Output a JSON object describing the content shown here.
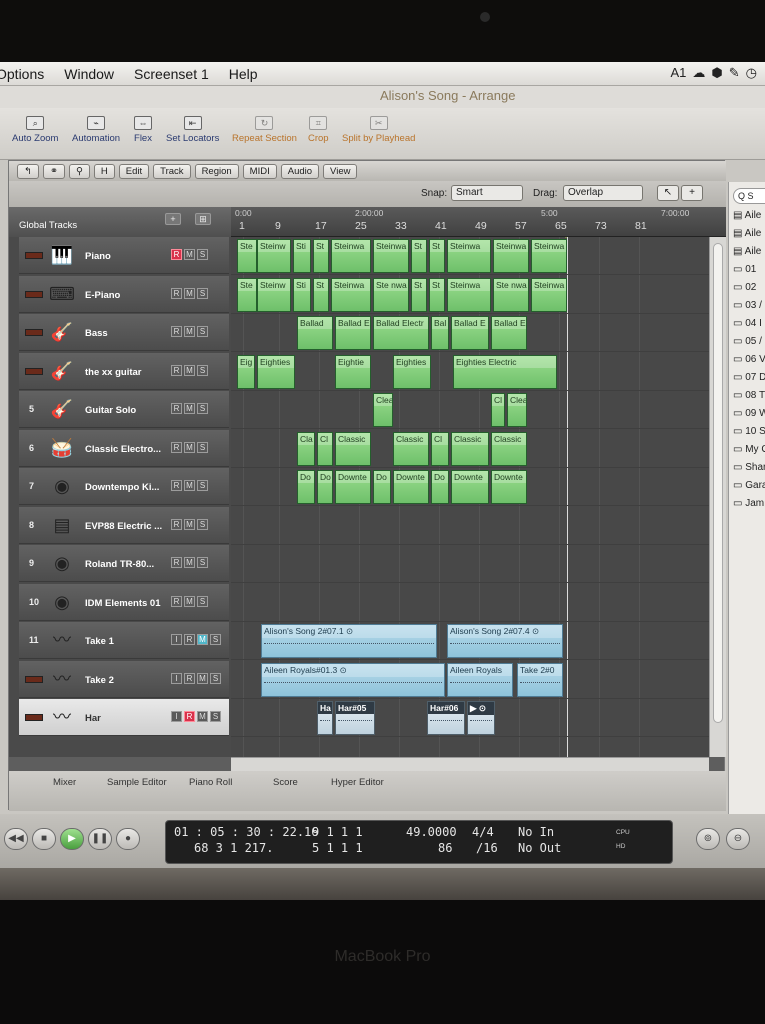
{
  "menubar": {
    "items": [
      "Options",
      "Window",
      "Screenset 1",
      "Help"
    ],
    "status": [
      "A1",
      "☁",
      "⬢",
      "✎",
      "◷"
    ]
  },
  "window": {
    "title": "Alison's Song - Arrange"
  },
  "toolbar": {
    "items": [
      "Auto Zoom",
      "Automation",
      "Flex",
      "Set Locators",
      "Repeat Section",
      "Crop",
      "Split by Playhead"
    ]
  },
  "local_menu": {
    "buttons": [
      "Edit",
      "Track",
      "Region",
      "MIDI",
      "Audio",
      "View"
    ],
    "snap_label": "Snap:",
    "snap_value": "Smart",
    "drag_label": "Drag:",
    "drag_value": "Overlap"
  },
  "global_tracks": {
    "label": "Global Tracks"
  },
  "ruler": {
    "bars": [
      "1",
      "9",
      "17",
      "25",
      "33",
      "41",
      "49",
      "57",
      "65",
      "73",
      "81"
    ],
    "times": [
      "0:00",
      "2:00:00",
      "5:00",
      "7:00:00"
    ]
  },
  "tracks": [
    {
      "num": "",
      "name": "Piano",
      "icon": "piano-icon",
      "glyph": "🎹",
      "btns": [
        "R",
        "M",
        "S"
      ],
      "rec": true
    },
    {
      "num": "",
      "name": "E-Piano",
      "icon": "keyboard-icon",
      "glyph": "⌨",
      "btns": [
        "R",
        "M",
        "S"
      ]
    },
    {
      "num": "",
      "name": "Bass",
      "icon": "bass-guitar-icon",
      "glyph": "🎸",
      "btns": [
        "R",
        "M",
        "S"
      ]
    },
    {
      "num": "",
      "name": "the xx guitar",
      "icon": "guitar-icon",
      "glyph": "🎸",
      "btns": [
        "R",
        "M",
        "S"
      ]
    },
    {
      "num": "5",
      "name": "Guitar Solo",
      "icon": "guitar-icon",
      "glyph": "🎸",
      "btns": [
        "R",
        "M",
        "S"
      ]
    },
    {
      "num": "6",
      "name": "Classic Electro...",
      "icon": "drumkit-icon",
      "glyph": "🥁",
      "btns": [
        "R",
        "M",
        "S"
      ]
    },
    {
      "num": "7",
      "name": "Downtempo Ki...",
      "icon": "drum-machine-icon",
      "glyph": "◉",
      "btns": [
        "R",
        "M",
        "S"
      ]
    },
    {
      "num": "8",
      "name": "EVP88 Electric ...",
      "icon": "electric-piano-icon",
      "glyph": "▤",
      "btns": [
        "R",
        "M",
        "S"
      ]
    },
    {
      "num": "9",
      "name": "Roland TR-80...",
      "icon": "drum-machine-icon",
      "glyph": "◉",
      "btns": [
        "R",
        "M",
        "S"
      ]
    },
    {
      "num": "10",
      "name": "IDM Elements 01",
      "icon": "drum-machine-icon",
      "glyph": "◉",
      "btns": [
        "R",
        "M",
        "S"
      ]
    },
    {
      "num": "11",
      "name": "Take 1",
      "icon": "waveform-icon",
      "glyph": "〰",
      "btns": [
        "I",
        "R",
        "M",
        "S"
      ],
      "mute_on": true
    },
    {
      "num": "",
      "name": "Take 2",
      "icon": "waveform-icon",
      "glyph": "〰",
      "btns": [
        "I",
        "R",
        "M",
        "S"
      ]
    },
    {
      "num": "",
      "name": "Har",
      "icon": "waveform-icon",
      "glyph": "〰",
      "btns": [
        "I",
        "R",
        "M",
        "S"
      ],
      "selected": true,
      "rec": true
    }
  ],
  "regions": {
    "piano": [
      "Ste",
      "Steinw",
      "Sti",
      "St",
      "Steinwa",
      "Steinwa",
      "St",
      "St",
      "Steinwa",
      "Steinwa",
      "Steinwa"
    ],
    "epiano": [
      "Ste",
      "Steinw",
      "Sti",
      "St",
      "Steinwa",
      "Ste nwa",
      "St",
      "St",
      "Steinwa",
      "Ste nwa",
      "Steinwa"
    ],
    "bass": [
      "Ballad",
      "Ballad E",
      "Ballad Electr",
      "Bal",
      "Ballad E",
      "Ballad E"
    ],
    "xx_guitar": [
      "Eig",
      "Eighties",
      "Eightie",
      "Eighties",
      "Eighties Electric"
    ],
    "guitar_solo": [
      "Clea",
      "Cl",
      "Clea"
    ],
    "classic_electro": [
      "Cla",
      "Cl",
      "Classic",
      "Classic",
      "Cl",
      "Classic",
      "Classic"
    ],
    "downtempo": [
      "Do",
      "Do",
      "Downte",
      "Do",
      "Downte",
      "Do",
      "Downte",
      "Downte"
    ],
    "take1": [
      "Alison's Song 2#07.1 ⊙",
      "Alison's Song 2#07.4 ⊙"
    ],
    "take2": [
      "Aileen Royals#01.3 ⊙",
      "Aileen Royals",
      "Take 2#0"
    ],
    "har": [
      "Ha",
      "Har#05",
      "Har#06",
      "▶ ⊙"
    ]
  },
  "bottom_tabs": [
    "Mixer",
    "Sample Editor",
    "Piano Roll",
    "Score",
    "Hyper Editor"
  ],
  "browser": {
    "search": "Q S",
    "items": [
      "Aile",
      "Aile",
      "Aile",
      "01",
      "02",
      "03 /",
      "04 I",
      "05 /",
      "06 V",
      "07 D",
      "08 T",
      "09 W",
      "10 S",
      "My G",
      "Share",
      "Garag",
      "Jam F"
    ]
  },
  "transport": {
    "time": "01 : 05 : 30 : 22.16",
    "time_sub": "68   3   1  217.",
    "bars": "9   1   1      1",
    "bars_sub": "5   1   1      1",
    "tempo": "49.0000",
    "tempo_sub": "86",
    "signature": "4/4",
    "division": "/16",
    "midi_in": "No In",
    "midi_out": "No Out",
    "cpu_label": "CPU",
    "hd_label": "HD"
  },
  "bezel": {
    "label": "MacBook Pro"
  }
}
